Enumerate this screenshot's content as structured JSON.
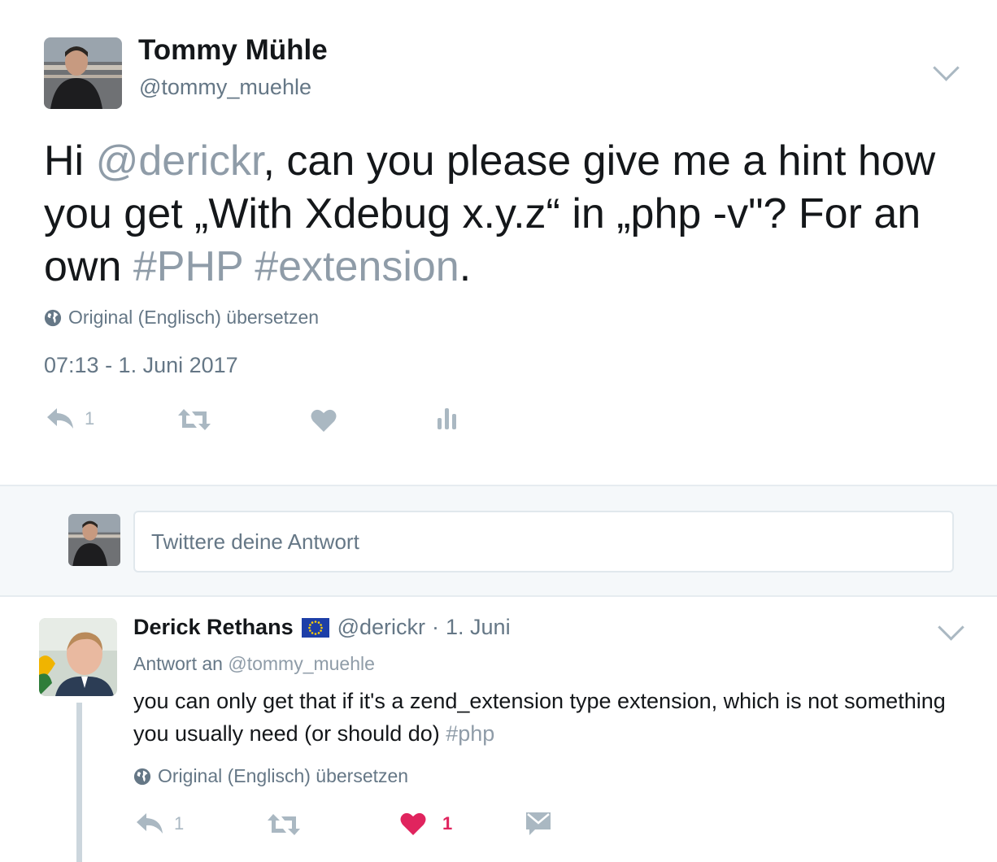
{
  "tweet": {
    "author": {
      "name": "Tommy Mühle",
      "handle": "@tommy_muehle"
    },
    "text": {
      "part1": "Hi ",
      "mention": "@derickr",
      "part2": ", can you please give me a hint how you get „With Xdebug x.y.z“ in „php -v\"? For an own ",
      "hashtag1": "#PHP",
      "space": " ",
      "hashtag2": "#extension",
      "part3": "."
    },
    "translate_label": "Original (Englisch) übersetzen",
    "timestamp": "07:13 - 1. Juni 2017",
    "actions": {
      "reply_count": "1"
    }
  },
  "reply_box": {
    "placeholder": "Twittere deine Antwort"
  },
  "reply": {
    "author": {
      "name": "Derick Rethans",
      "handle": "@derickr",
      "separator": "·",
      "date": "1. Juni"
    },
    "reply_to_label": "Antwort an",
    "reply_to_handle": "@tommy_muehle",
    "text": {
      "body": "you can only get that if it's a zend_extension type extension, which is not something you usually need (or should do) ",
      "hashtag": "#php"
    },
    "translate_label": "Original (Englisch) übersetzen",
    "actions": {
      "reply_count": "1",
      "like_count": "1"
    }
  },
  "colors": {
    "text": "#14171a",
    "muted": "#657786",
    "link": "#8f9ca8",
    "icon": "#aab8c2",
    "like_active": "#e0245e",
    "band": "#f5f8fa"
  },
  "icons": [
    "chevron-down-icon",
    "globe-icon",
    "reply-icon",
    "retweet-icon",
    "heart-icon",
    "analytics-icon",
    "direct-message-icon",
    "eu-flag-icon"
  ]
}
